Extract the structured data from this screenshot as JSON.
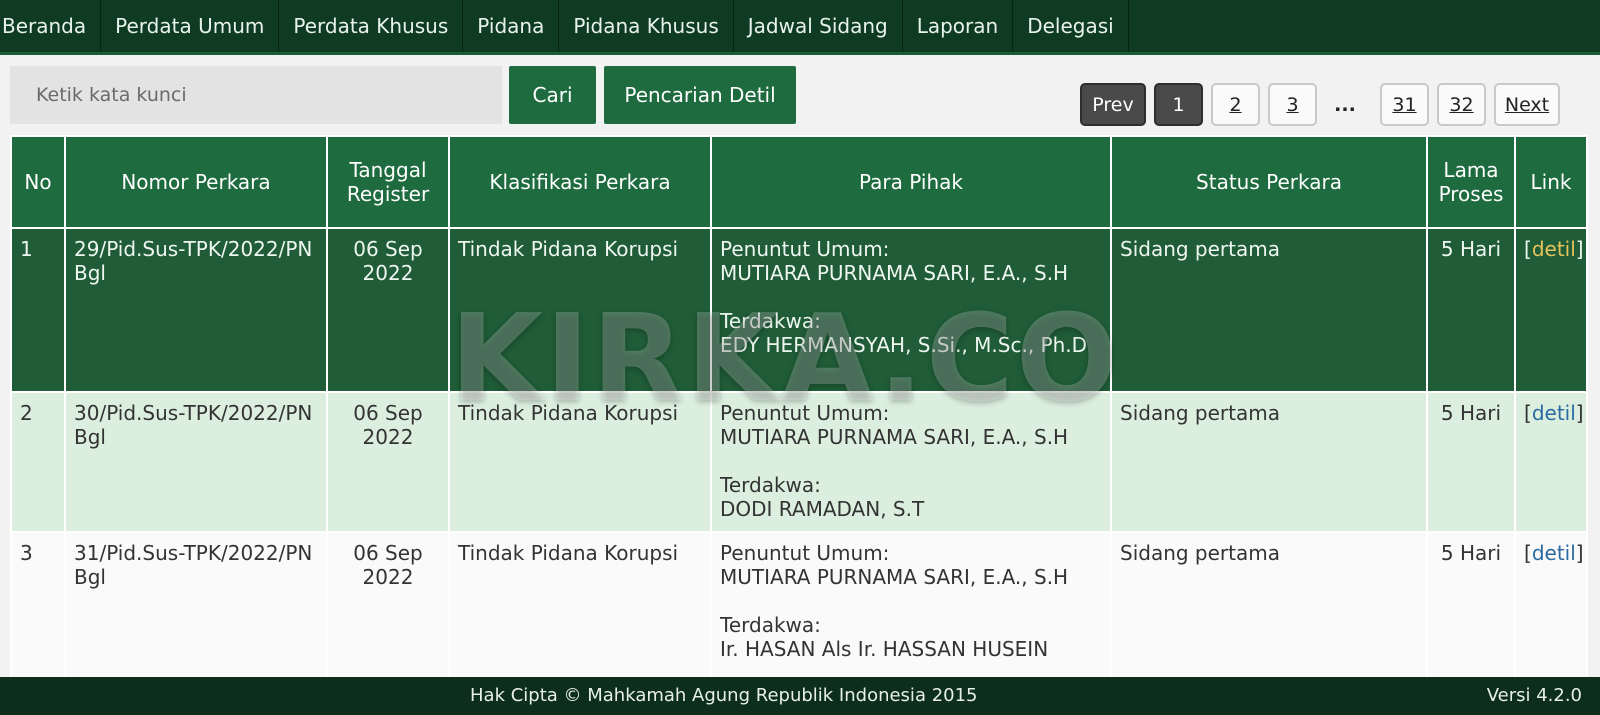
{
  "nav": {
    "items": [
      "Beranda",
      "Perdata Umum",
      "Perdata Khusus",
      "Pidana",
      "Pidana Khusus",
      "Jadwal Sidang",
      "Laporan",
      "Delegasi"
    ]
  },
  "search": {
    "placeholder": "Ketik kata kunci",
    "value": "",
    "search_label": "Cari",
    "advanced_label": "Pencarian Detil"
  },
  "pagination": {
    "prev": "Prev",
    "current": "1",
    "pages": [
      "2",
      "3"
    ],
    "ellipsis": "...",
    "last_pages": [
      "31",
      "32"
    ],
    "next": "Next"
  },
  "table": {
    "headers": {
      "no": "No",
      "nomor": "Nomor Perkara",
      "tanggal": "Tanggal Register",
      "klasifikasi": "Klasifikasi Perkara",
      "pihak": "Para Pihak",
      "status": "Status Perkara",
      "lama": "Lama Proses",
      "link": "Link"
    },
    "rows": [
      {
        "no": "1",
        "nomor": "29/Pid.Sus-TPK/2022/PN Bgl",
        "tanggal": "06 Sep 2022",
        "klasifikasi": "Tindak Pidana Korupsi",
        "penuntut_label": "Penuntut Umum:",
        "penuntut": "MUTIARA PURNAMA SARI, E.A., S.H",
        "terdakwa_label": "Terdakwa:",
        "terdakwa": "EDY HERMANSYAH, S.Si., M.Sc., Ph.D",
        "status": "Sidang pertama",
        "lama": "5 Hari",
        "link_open": "[",
        "link": "detil",
        "link_close": "]"
      },
      {
        "no": "2",
        "nomor": "30/Pid.Sus-TPK/2022/PN Bgl",
        "tanggal": "06 Sep 2022",
        "klasifikasi": "Tindak Pidana Korupsi",
        "penuntut_label": "Penuntut Umum:",
        "penuntut": "MUTIARA PURNAMA SARI, E.A., S.H",
        "terdakwa_label": "Terdakwa:",
        "terdakwa": "DODI RAMADAN, S.T",
        "status": "Sidang pertama",
        "lama": "5 Hari",
        "link_open": "[",
        "link": "detil",
        "link_close": "]"
      },
      {
        "no": "3",
        "nomor": "31/Pid.Sus-TPK/2022/PN Bgl",
        "tanggal": "06 Sep 2022",
        "klasifikasi": "Tindak Pidana Korupsi",
        "penuntut_label": "Penuntut Umum:",
        "penuntut": "MUTIARA PURNAMA SARI, E.A., S.H",
        "terdakwa_label": "Terdakwa:",
        "terdakwa": "Ir. HASAN Als Ir. HASSAN HUSEIN",
        "status": "Sidang pertama",
        "lama": "5 Hari",
        "link_open": "[",
        "link": "detil",
        "link_close": "]"
      }
    ]
  },
  "watermark": "KIRKA.CO",
  "footer": {
    "copyright": "Hak Cipta © Mahkamah Agung Republik Indonesia 2015",
    "version": "Versi 4.2.0"
  }
}
